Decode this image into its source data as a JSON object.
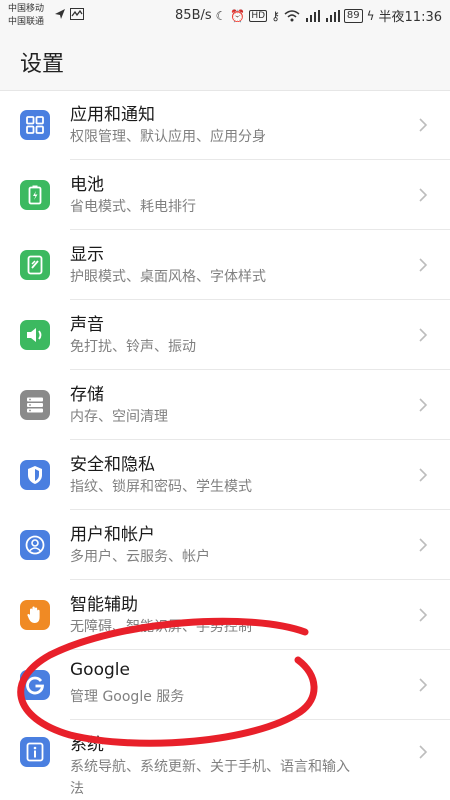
{
  "status_bar": {
    "carrier_1": "中国移动",
    "carrier_2": "中国联通",
    "net_speed": "85B/s",
    "battery": "89",
    "time": "半夜11:36"
  },
  "header": {
    "title": "设置"
  },
  "items": [
    {
      "label": "应用和通知",
      "sub": "权限管理、默认应用、应用分身",
      "icon": "apps-icon",
      "color": "#4a7fe0"
    },
    {
      "label": "电池",
      "sub": "省电模式、耗电排行",
      "icon": "battery-icon",
      "color": "#3cb960"
    },
    {
      "label": "显示",
      "sub": "护眼模式、桌面风格、字体样式",
      "icon": "display-icon",
      "color": "#3cb960"
    },
    {
      "label": "声音",
      "sub": "免打扰、铃声、振动",
      "icon": "sound-icon",
      "color": "#3cb960"
    },
    {
      "label": "存储",
      "sub": "内存、空间清理",
      "icon": "storage-icon",
      "color": "#8a8a8a"
    },
    {
      "label": "安全和隐私",
      "sub": "指纹、锁屏和密码、学生模式",
      "icon": "shield-icon",
      "color": "#4a7fe0"
    },
    {
      "label": "用户和帐户",
      "sub": "多用户、云服务、帐户",
      "icon": "user-icon",
      "color": "#4a7fe0"
    },
    {
      "label": "智能辅助",
      "sub": "无障碍、智能识屏、手势控制",
      "icon": "hand-icon",
      "color": "#f08a24"
    },
    {
      "label": "Google",
      "sub": "管理 Google 服务",
      "icon": "google-icon",
      "color": "#4a7fe0"
    },
    {
      "label": "系统",
      "sub_line1": "系统导航、系统更新、关于手机、语言和输入",
      "sub_line2": "法",
      "icon": "info-icon",
      "color": "#4a7fe0"
    }
  ],
  "annotation_color": "#e8202a"
}
